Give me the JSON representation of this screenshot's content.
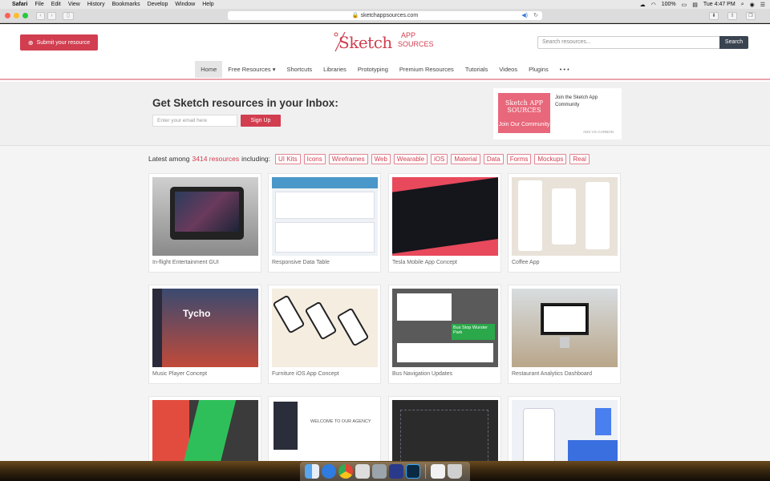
{
  "menubar": {
    "app": "Safari",
    "items": [
      "File",
      "Edit",
      "View",
      "History",
      "Bookmarks",
      "Develop",
      "Window",
      "Help"
    ],
    "battery": "100%",
    "clock": "Tue 4:47 PM"
  },
  "browser": {
    "url": "sketchappsources.com"
  },
  "header": {
    "submit_label": "Submit your resource",
    "logo_main": "Sketch",
    "logo_app": "APP",
    "logo_sources": "SOURCES",
    "search_placeholder": "Search resources...",
    "search_button": "Search"
  },
  "nav": {
    "items": [
      "Home",
      "Free Resources ▾",
      "Shortcuts",
      "Libraries",
      "Prototyping",
      "Premium Resources",
      "Tutorials",
      "Videos",
      "Plugins",
      "• • •"
    ]
  },
  "newsletter": {
    "heading": "Get Sketch resources in your Inbox:",
    "email_placeholder": "Enter your email here",
    "signup_label": "Sign Up"
  },
  "ad": {
    "logo_text": "Sketch APP SOURCES",
    "cta": "Join Our Community",
    "text": "Join the Sketch App Community",
    "via": "ADS VIA CARBON"
  },
  "latest": {
    "prefix": "Latest among",
    "count": "3414 resources",
    "suffix": "including:",
    "tags": [
      "UI Kits",
      "Icons",
      "Wireframes",
      "Web",
      "Wearable",
      "iOS",
      "Material",
      "Data",
      "Forms",
      "Mockups",
      "Real"
    ]
  },
  "cards": [
    {
      "title": "In-flight Entertainment GUI"
    },
    {
      "title": "Responsive Data Table"
    },
    {
      "title": "Tesla Mobile App Concept"
    },
    {
      "title": "Coffee App"
    },
    {
      "title": "Music Player Concept",
      "thumb_text": "Tycho"
    },
    {
      "title": "Furniture iOS App Concept"
    },
    {
      "title": "Bus Navigation Updates",
      "thumb_text": "Bus Stop Wurster Park"
    },
    {
      "title": "Restaurant Analytics Dashboard"
    },
    {
      "title": ""
    },
    {
      "title": "",
      "thumb_text": "WELCOME TO OUR AGENCY"
    },
    {
      "title": ""
    },
    {
      "title": ""
    }
  ],
  "colors": {
    "brand": "#d13e4f",
    "search_button": "#3a4451"
  }
}
